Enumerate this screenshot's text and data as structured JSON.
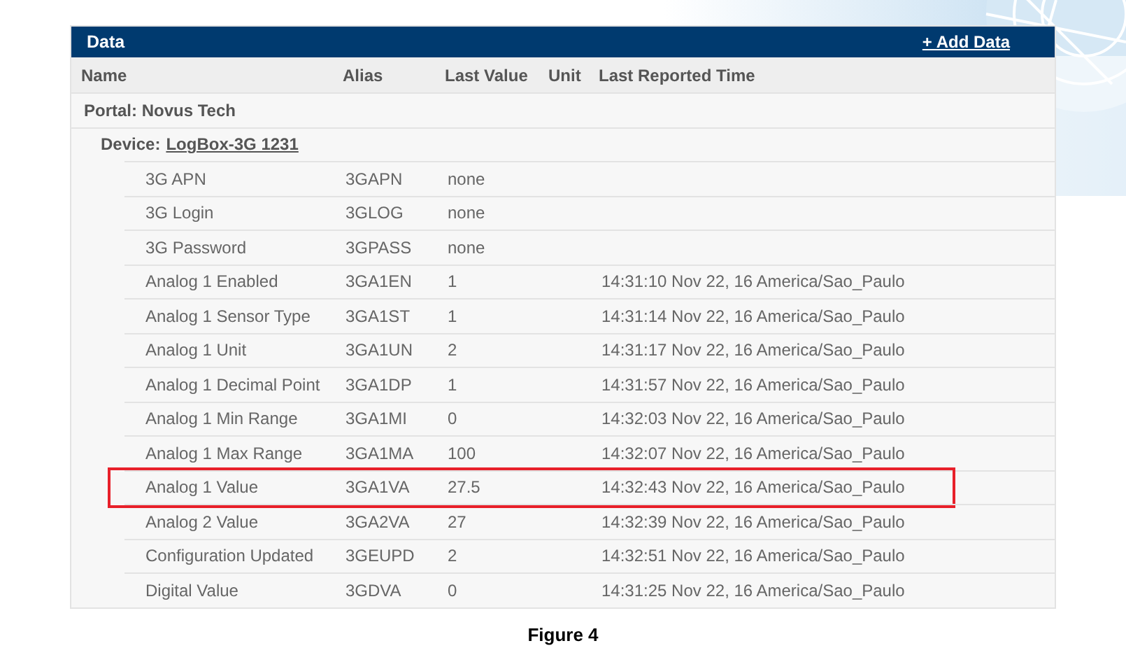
{
  "panel": {
    "title": "Data",
    "add_link": "+ Add Data"
  },
  "table": {
    "columns": [
      "Name",
      "Alias",
      "Last Value",
      "Unit",
      "Last Reported Time"
    ],
    "portal": {
      "label": "Portal: Novus Tech"
    },
    "device": {
      "label": "Device:",
      "link": "LogBox-3G 1231"
    },
    "rows": [
      {
        "name": "3G APN",
        "alias": "3GAPN",
        "value": "none",
        "highlighted": false
      },
      {
        "name": "3G Login",
        "alias": "3GLOG",
        "value": "none",
        "highlighted": false
      },
      {
        "name": "3G Password",
        "alias": "3GPASS",
        "value": "none",
        "highlighted": false
      },
      {
        "name": "Analog 1 Enabled",
        "alias": "3GA1EN",
        "value": "1",
        "time": "14:31:10 Nov 22, 16 America/Sao_Paulo",
        "highlighted": false
      },
      {
        "name": "Analog 1 Sensor Type",
        "alias": "3GA1ST",
        "value": "1",
        "time": "14:31:14 Nov 22, 16 America/Sao_Paulo",
        "highlighted": false
      },
      {
        "name": "Analog 1 Unit",
        "alias": "3GA1UN",
        "value": "2",
        "time": "14:31:17 Nov 22, 16 America/Sao_Paulo",
        "highlighted": false
      },
      {
        "name": "Analog 1 Decimal Point",
        "alias": "3GA1DP",
        "value": "1",
        "time": "14:31:57 Nov 22, 16 America/Sao_Paulo",
        "highlighted": false
      },
      {
        "name": "Analog 1 Min Range",
        "alias": "3GA1MI",
        "value": "0",
        "time": "14:32:03 Nov 22, 16 America/Sao_Paulo",
        "highlighted": false
      },
      {
        "name": "Analog 1 Max Range",
        "alias": "3GA1MA",
        "value": "100",
        "time": "14:32:07 Nov 22, 16 America/Sao_Paulo",
        "highlighted": false
      },
      {
        "name": "Analog 1 Value",
        "alias": "3GA1VA",
        "value": "27.5",
        "time": "14:32:43 Nov 22, 16 America/Sao_Paulo",
        "highlighted": true
      },
      {
        "name": "Analog 2 Value",
        "alias": "3GA2VA",
        "value": "27",
        "time": "14:32:39 Nov 22, 16 America/Sao_Paulo",
        "highlighted": false
      },
      {
        "name": "Configuration Updated",
        "alias": "3GEUPD",
        "value": "2",
        "time": "14:32:51 Nov 22, 16 America/Sao_Paulo",
        "highlighted": false
      },
      {
        "name": "Digital Value",
        "alias": "3GDVA",
        "value": "0",
        "time": "14:31:25 Nov 22, 16 America/Sao_Paulo",
        "highlighted": false
      }
    ]
  },
  "caption": "Figure 4"
}
